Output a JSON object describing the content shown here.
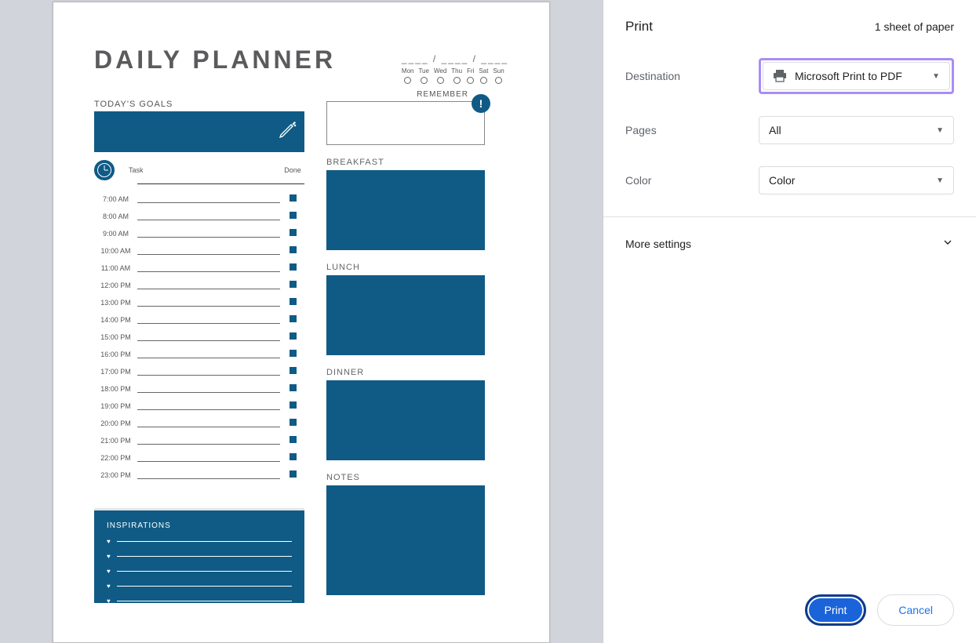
{
  "planner": {
    "title": "DAILY PLANNER",
    "date_pattern": "____ / ____ / ____",
    "days": [
      "Mon",
      "Tue",
      "Wed",
      "Thu",
      "Fri",
      "Sat",
      "Sun"
    ],
    "goals_label": "TODAY'S GOALS",
    "remember_label": "REMEMBER",
    "alert_symbol": "!",
    "task_header": "Task",
    "done_header": "Done",
    "times": [
      "7:00 AM",
      "8:00 AM",
      "9:00 AM",
      "10:00 AM",
      "11:00 AM",
      "12:00 PM",
      "13:00 PM",
      "14:00 PM",
      "15:00 PM",
      "16:00 PM",
      "17:00 PM",
      "18:00 PM",
      "19:00 PM",
      "20:00 PM",
      "21:00 PM",
      "22:00 PM",
      "23:00 PM"
    ],
    "meals": {
      "breakfast": "BREAKFAST",
      "lunch": "LUNCH",
      "dinner": "DINNER",
      "notes": "NOTES"
    },
    "inspirations_label": "INSPIRATIONS"
  },
  "print": {
    "title": "Print",
    "sheet_count": "1 sheet of paper",
    "destination_label": "Destination",
    "destination_value": "Microsoft Print to PDF",
    "pages_label": "Pages",
    "pages_value": "All",
    "color_label": "Color",
    "color_value": "Color",
    "more_settings": "More settings",
    "print_button": "Print",
    "cancel_button": "Cancel"
  }
}
